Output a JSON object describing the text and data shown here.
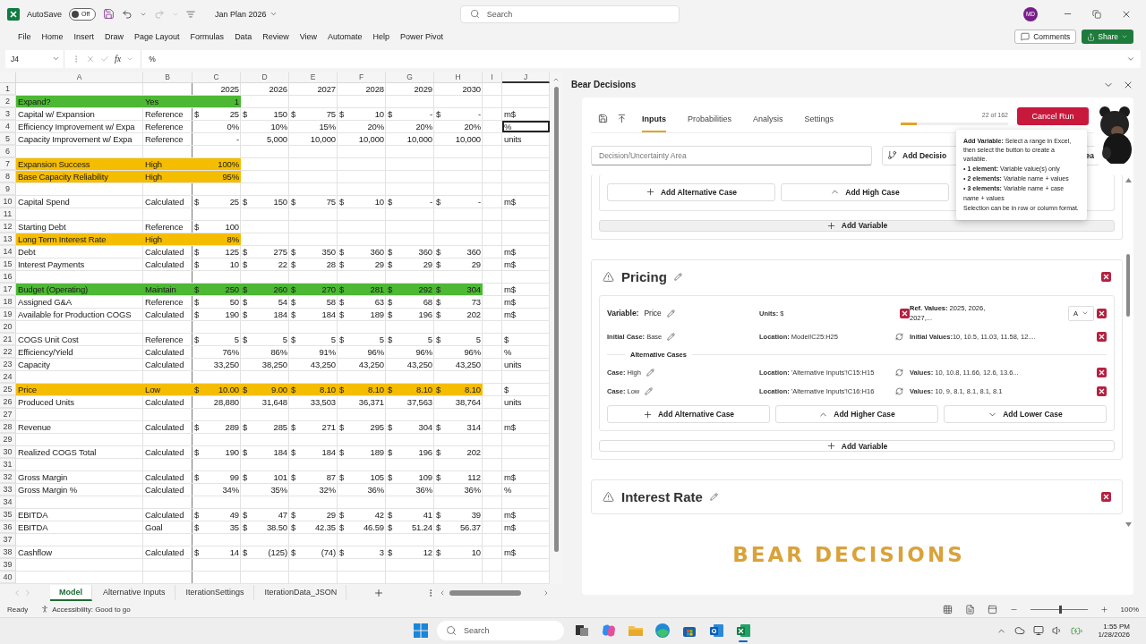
{
  "titlebar": {
    "autosave_label": "AutoSave",
    "autosave": {
      "on": false,
      "text": "Off"
    },
    "file_name": "Jan Plan 2026",
    "search": {
      "placeholder": "Search"
    },
    "avatar": "MD"
  },
  "menu": {
    "items": [
      "File",
      "Home",
      "Insert",
      "Draw",
      "Page Layout",
      "Formulas",
      "Data",
      "Review",
      "View",
      "Automate",
      "Help",
      "Power Pivot"
    ],
    "comments": "Comments",
    "share": "Share"
  },
  "formula_bar": {
    "name_box": "J4",
    "fx": "fx",
    "value": "%"
  },
  "sheet": {
    "columns": [
      {
        "label": "A",
        "selected": false
      },
      {
        "label": "B",
        "selected": false
      },
      {
        "label": "C",
        "selected": false
      },
      {
        "label": "D",
        "selected": false
      },
      {
        "label": "E",
        "selected": false
      },
      {
        "label": "F",
        "selected": false
      },
      {
        "label": "G",
        "selected": false
      },
      {
        "label": "H",
        "selected": false
      },
      {
        "label": "I",
        "selected": false
      },
      {
        "label": "J",
        "selected": true
      }
    ],
    "rows": [
      {
        "n": "1",
        "values": [
          "2025",
          "2026",
          "2027",
          "2028",
          "2029",
          "2030"
        ]
      },
      {
        "n": "2",
        "a": "Expand?",
        "b": "Yes",
        "values": [
          "1"
        ],
        "color": "#4cb833"
      },
      {
        "n": "3",
        "a": "Capital w/ Expansion",
        "b": "Reference",
        "currency": "$",
        "values": [
          "25",
          "150",
          "75",
          "10",
          "-",
          "-"
        ],
        "unit": "m$",
        "unit_selected": false
      },
      {
        "n": "4",
        "a": "Efficiency Improvement w/ Expa",
        "b": "Reference",
        "values": [
          "0%",
          "10%",
          "15%",
          "20%",
          "20%",
          "20%"
        ],
        "unit": "%",
        "unit_selected": true
      },
      {
        "n": "5",
        "a": "Capacity Improvement w/ Expa",
        "b": "Reference",
        "values": [
          "-",
          "5,000",
          "10,000",
          "10,000",
          "10,000",
          "10,000"
        ],
        "unit": "units",
        "unit_selected": false
      },
      {
        "n": "6"
      },
      {
        "n": "7",
        "a": "Expansion Success",
        "b": "High",
        "values": [
          "100%"
        ],
        "color": "#f5bd00"
      },
      {
        "n": "8",
        "a": "Base Capacity Reliability",
        "b": "High",
        "values": [
          "95%"
        ],
        "color": "#f5bd00"
      },
      {
        "n": "9"
      },
      {
        "n": "10",
        "a": "Capital Spend",
        "b": "Calculated",
        "currency": "$",
        "values": [
          "25",
          "150",
          "75",
          "10",
          "-",
          "-"
        ],
        "unit": "m$",
        "unit_selected": false
      },
      {
        "n": "11"
      },
      {
        "n": "12",
        "a": "Starting Debt",
        "b": "Reference",
        "currency": "$",
        "values": [
          "100"
        ]
      },
      {
        "n": "13",
        "a": "Long Term Interest Rate",
        "b": "High",
        "values": [
          "8%"
        ],
        "color": "#f5bd00"
      },
      {
        "n": "14",
        "a": "Debt",
        "b": "Calculated",
        "currency": "$",
        "values": [
          "125",
          "275",
          "350",
          "360",
          "360",
          "360"
        ],
        "unit": "m$",
        "unit_selected": false
      },
      {
        "n": "15",
        "a": "Interest Payments",
        "b": "Calculated",
        "currency": "$",
        "values": [
          "10",
          "22",
          "28",
          "29",
          "29",
          "29"
        ],
        "unit": "m$",
        "unit_selected": false
      },
      {
        "n": "16"
      },
      {
        "n": "17",
        "a": "Budget (Operating)",
        "b": "Maintain",
        "currency": "$",
        "values": [
          "250",
          "260",
          "270",
          "281",
          "292",
          "304"
        ],
        "unit": "m$",
        "unit_selected": false,
        "color": "#4cb833"
      },
      {
        "n": "18",
        "a": "Assigned G&A",
        "b": "Reference",
        "currency": "$",
        "values": [
          "50",
          "54",
          "58",
          "63",
          "68",
          "73"
        ],
        "unit": "m$",
        "unit_selected": false
      },
      {
        "n": "19",
        "a": "Available for Production COGS",
        "b": "Calculated",
        "currency": "$",
        "values": [
          "190",
          "184",
          "184",
          "189",
          "196",
          "202"
        ],
        "unit": "m$",
        "unit_selected": false
      },
      {
        "n": "20"
      },
      {
        "n": "21",
        "a": "COGS Unit Cost",
        "b": "Reference",
        "currency": "$",
        "values": [
          "5",
          "5",
          "5",
          "5",
          "5",
          "5"
        ],
        "unit": "$",
        "unit_selected": false
      },
      {
        "n": "22",
        "a": "Efficiency/Yield",
        "b": "Calculated",
        "values": [
          "76%",
          "86%",
          "91%",
          "96%",
          "96%",
          "96%"
        ],
        "unit": "%",
        "unit_selected": false
      },
      {
        "n": "23",
        "a": "Capacity",
        "b": "Calculated",
        "values": [
          "33,250",
          "38,250",
          "43,250",
          "43,250",
          "43,250",
          "43,250"
        ],
        "unit": "units",
        "unit_selected": false
      },
      {
        "n": "24"
      },
      {
        "n": "25",
        "a": "Price",
        "b": "Low",
        "currency": "$",
        "values": [
          "10.00",
          "9.00",
          "8.10",
          "8.10",
          "8.10",
          "8.10"
        ],
        "unit": "$",
        "unit_selected": false,
        "color": "#f5bd00"
      },
      {
        "n": "26",
        "a": "Produced Units",
        "b": "Calculated",
        "values": [
          "28,880",
          "31,648",
          "33,503",
          "36,371",
          "37,563",
          "38,764"
        ],
        "unit": "units",
        "unit_selected": false
      },
      {
        "n": "27"
      },
      {
        "n": "28",
        "a": "Revenue",
        "b": "Calculated",
        "currency": "$",
        "values": [
          "289",
          "285",
          "271",
          "295",
          "304",
          "314"
        ],
        "unit": "m$",
        "unit_selected": false
      },
      {
        "n": "29"
      },
      {
        "n": "30",
        "a": "Realized COGS Total",
        "b": "Calculated",
        "currency": "$",
        "values": [
          "190",
          "184",
          "184",
          "189",
          "196",
          "202"
        ]
      },
      {
        "n": "31"
      },
      {
        "n": "32",
        "a": "Gross Margin",
        "b": "Calculated",
        "currency": "$",
        "values": [
          "99",
          "101",
          "87",
          "105",
          "109",
          "112"
        ],
        "unit": "m$",
        "unit_selected": false
      },
      {
        "n": "33",
        "a": "Gross Margin %",
        "b": "Calculated",
        "values": [
          "34%",
          "35%",
          "32%",
          "36%",
          "36%",
          "36%"
        ],
        "unit": "%",
        "unit_selected": false
      },
      {
        "n": "34"
      },
      {
        "n": "35",
        "a": "EBITDA",
        "b": "Calculated",
        "currency": "$",
        "values": [
          "49",
          "47",
          "29",
          "42",
          "41",
          "39"
        ],
        "unit": "m$",
        "unit_selected": false
      },
      {
        "n": "36",
        "a": "EBITDA",
        "b": "Goal",
        "currency": "$",
        "values": [
          "35",
          "38.50",
          "42.35",
          "46.59",
          "51.24",
          "56.37"
        ],
        "unit": "m$",
        "unit_selected": false
      },
      {
        "n": "37"
      },
      {
        "n": "38",
        "a": "Cashflow",
        "b": "Calculated",
        "currency": "$",
        "values": [
          "14",
          "(125)",
          "(74)",
          "3",
          "12",
          "10"
        ],
        "unit": "m$",
        "unit_selected": false
      },
      {
        "n": "39"
      },
      {
        "n": "40"
      }
    ]
  },
  "sheet_tabs": [
    {
      "label": "Model",
      "selected": true
    },
    {
      "label": "Alternative Inputs",
      "selected": false
    },
    {
      "label": "IterationSettings",
      "selected": false
    },
    {
      "label": "IterationData_JSON",
      "selected": false
    }
  ],
  "status_bar": {
    "ready": "Ready",
    "accessibility": "Accessibility: Good to go",
    "zoom": {
      "level": 0.5
    },
    "zoom_text": "100%"
  },
  "panel": {
    "title": "Bear Decisions",
    "tabs": [
      {
        "label": "Inputs",
        "selected": true
      },
      {
        "label": "Probabilities",
        "selected": false
      },
      {
        "label": "Analysis",
        "selected": false
      },
      {
        "label": "Settings",
        "selected": false
      }
    ],
    "progress": {
      "text": "22 of 162",
      "level": 0.15
    },
    "cancel": "Cancel Run",
    "area_field": {
      "placeholder": "Decision/Uncertainty Area"
    },
    "add_decision": "Add Decisio",
    "add_uncertainty": "ea",
    "tooltip": [
      "**Add Variable:** Select a range in Excel, then select the button to create a variable.",
      "• **1 element:** Variable value(s) only",
      "• **2 elements:** Variable name + values",
      "• **3 elements:** Variable name + case name + values",
      "Selection can be in row or column format."
    ],
    "prev_buttons": [
      {
        "kind": "add",
        "label": "Add Alternative Case"
      },
      {
        "kind": "higher",
        "label": "Add High Case"
      }
    ],
    "add_variable_top": {
      "label": "Add Variable",
      "hovered": true
    },
    "sections": [
      {
        "title": "Pricing",
        "variables": [
          {
            "label": "Variable:",
            "name": "Price",
            "units": "**Units:** $",
            "ref_values": "**Ref. Values:** 2025, 2026, 2027,...",
            "ref_select": "A",
            "initial_case": "**Initial Case:** Base",
            "location": "**Location:** Model!C25:H25",
            "initial_values": "**Initial Values:**10, 10.5, 11.03, 11.58, 12....",
            "alt_label": "Alternative Cases",
            "cases": [
              {
                "case": "**Case:** High",
                "location": "**Location:** 'Alternative Inputs'!C15:H15",
                "values": "**Values:** 10, 10.8, 11.66, 12.6, 13.6..."
              },
              {
                "case": "**Case:** Low",
                "location": "**Location:** 'Alternative Inputs'!C16:H16",
                "values": "**Values:** 10, 9, 8.1, 8.1, 8.1, 8.1"
              }
            ],
            "buttons": [
              {
                "kind": "add",
                "label": "Add Alternative Case"
              },
              {
                "kind": "higher",
                "label": "Add Higher Case"
              },
              {
                "kind": "lower",
                "label": "Add Lower Case"
              }
            ]
          }
        ],
        "add_variable": "Add Variable"
      },
      {
        "title": "Interest Rate"
      }
    ],
    "logo": "BEAR DECISIONS"
  },
  "taskbar": {
    "search": {
      "placeholder": "Search"
    },
    "apps": [
      {
        "kind": "taskview",
        "active": false
      },
      {
        "kind": "copilot",
        "active": false
      },
      {
        "kind": "folder",
        "active": false
      },
      {
        "kind": "browser",
        "active": false
      },
      {
        "kind": "store",
        "active": false
      },
      {
        "kind": "mail",
        "active": false
      },
      {
        "kind": "sheet",
        "active": true
      }
    ],
    "time": "1:55 PM",
    "date": "1/28/2026"
  }
}
